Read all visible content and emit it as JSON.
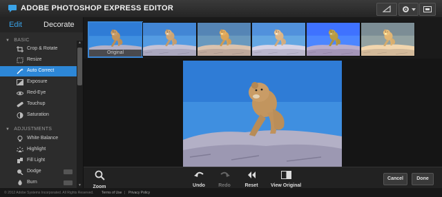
{
  "app": {
    "title": "ADOBE PHOTOSHOP EXPRESS EDITOR",
    "accent": "#2d87d7"
  },
  "tabs": {
    "edit": "Edit",
    "decorate": "Decorate"
  },
  "sidebar": {
    "sections": [
      {
        "title": "BASIC"
      },
      {
        "title": "ADJUSTMENTS"
      }
    ],
    "basic_items": [
      {
        "label": "Crop & Rotate",
        "icon": "crop-icon"
      },
      {
        "label": "Resize",
        "icon": "resize-icon"
      },
      {
        "label": "Auto Correct",
        "icon": "magic-wand-icon",
        "active": true
      },
      {
        "label": "Exposure",
        "icon": "exposure-icon"
      },
      {
        "label": "Red-Eye",
        "icon": "eye-icon"
      },
      {
        "label": "Touchup",
        "icon": "bandage-icon"
      },
      {
        "label": "Saturation",
        "icon": "saturation-icon"
      }
    ],
    "adjust_items": [
      {
        "label": "White Balance",
        "icon": "bulb-icon"
      },
      {
        "label": "Highlight",
        "icon": "highlight-icon"
      },
      {
        "label": "Fill Light",
        "icon": "fill-light-icon"
      },
      {
        "label": "Dodge",
        "icon": "dodge-icon"
      },
      {
        "label": "Burn",
        "icon": "burn-icon"
      }
    ]
  },
  "thumbnails": {
    "original_caption": "Original",
    "selected_index": 0
  },
  "toolbar": {
    "zoom": "Zoom",
    "undo": "Undo",
    "redo": "Redo",
    "reset": "Reset",
    "view_original": "View Original",
    "cancel": "Cancel",
    "done": "Done"
  },
  "footer": {
    "copyright": "© 2012 Adobe Systems Incorporated. All Rights Reserved.",
    "terms": "Terms of Use",
    "separator": "|",
    "privacy": "Privacy Policy"
  }
}
